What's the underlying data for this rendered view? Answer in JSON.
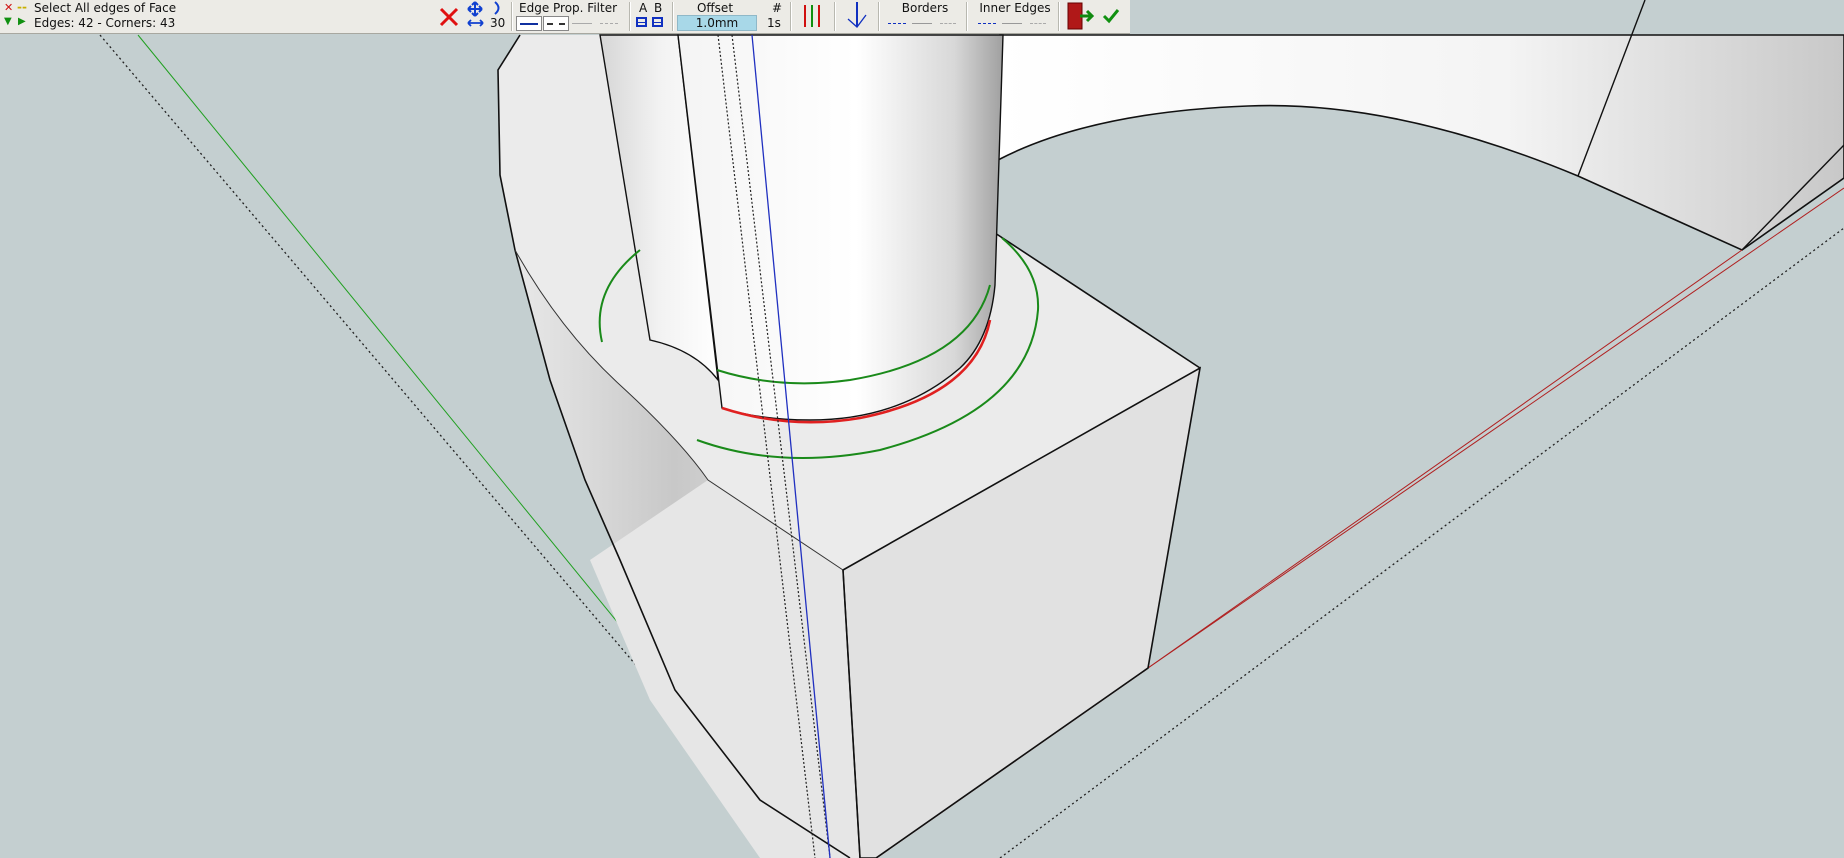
{
  "status": {
    "line1": "Select All edges of Face",
    "line2": "Edges: 42 - Corners: 43"
  },
  "toolbar": {
    "segments_value": "30",
    "edge_filter_label": "Edge Prop. Filter",
    "a_label": "A",
    "b_label": "B",
    "offset_label": "Offset",
    "offset_value": "1.0mm",
    "hash_label": "#",
    "count_value": "1s",
    "borders_label": "Borders",
    "inner_edges_label": "Inner Edges"
  },
  "icons": {
    "cancel": "close-icon",
    "move": "move-arrows-icon",
    "arc": "arc-icon",
    "width": "horizontal-arrows-icon",
    "multi_lines": "parallel-lines-icon",
    "normal_axis": "axis-icon",
    "exit": "exit-door-icon",
    "validate": "checkmark-icon"
  },
  "colors": {
    "toolbar_bg": "#ecebe6",
    "viewport_bg": "#c4cfd0",
    "offset_field": "#a8d8e8",
    "selected_edge": "#e02020",
    "offset_curve": "#1a8a1a",
    "axis_blue": "#2030c0"
  }
}
